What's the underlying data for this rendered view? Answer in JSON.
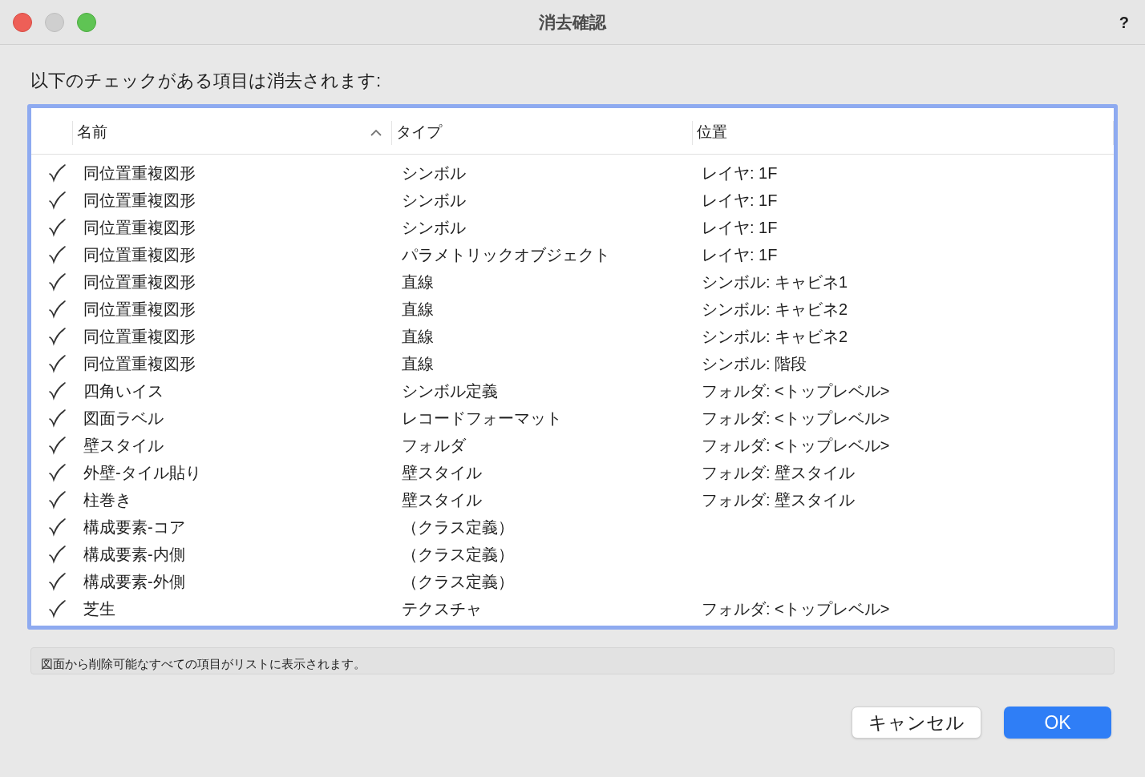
{
  "window": {
    "title": "消去確認",
    "help": "?"
  },
  "prompt": "以下のチェックがある項目は消去されます:",
  "table": {
    "columns": [
      {
        "label": "名前",
        "sorted": true
      },
      {
        "label": "タイプ",
        "sorted": false
      },
      {
        "label": "位置",
        "sorted": false
      }
    ],
    "rows": [
      {
        "checked": true,
        "name": "同位置重複図形",
        "type": "シンボル",
        "location": "レイヤ: 1F"
      },
      {
        "checked": true,
        "name": "同位置重複図形",
        "type": "シンボル",
        "location": "レイヤ: 1F"
      },
      {
        "checked": true,
        "name": "同位置重複図形",
        "type": "シンボル",
        "location": "レイヤ: 1F"
      },
      {
        "checked": true,
        "name": "同位置重複図形",
        "type": "パラメトリックオブジェクト",
        "location": "レイヤ: 1F"
      },
      {
        "checked": true,
        "name": "同位置重複図形",
        "type": "直線",
        "location": "シンボル: キャビネ1"
      },
      {
        "checked": true,
        "name": "同位置重複図形",
        "type": "直線",
        "location": "シンボル: キャビネ2"
      },
      {
        "checked": true,
        "name": "同位置重複図形",
        "type": "直線",
        "location": "シンボル: キャビネ2"
      },
      {
        "checked": true,
        "name": "同位置重複図形",
        "type": "直線",
        "location": "シンボル: 階段"
      },
      {
        "checked": true,
        "name": "四角いイス",
        "type": "シンボル定義",
        "location": "フォルダ: <トップレベル>"
      },
      {
        "checked": true,
        "name": "図面ラベル",
        "type": "レコードフォーマット",
        "location": "フォルダ: <トップレベル>"
      },
      {
        "checked": true,
        "name": "壁スタイル",
        "type": "フォルダ",
        "location": "フォルダ: <トップレベル>"
      },
      {
        "checked": true,
        "name": "外壁-タイル貼り",
        "type": "壁スタイル",
        "location": "フォルダ: 壁スタイル"
      },
      {
        "checked": true,
        "name": "柱巻き",
        "type": "壁スタイル",
        "location": "フォルダ: 壁スタイル"
      },
      {
        "checked": true,
        "name": "構成要素-コア",
        "type": "（クラス定義）"
      },
      {
        "checked": true,
        "name": "構成要素-内側",
        "type": "（クラス定義）"
      },
      {
        "checked": true,
        "name": "構成要素-外側",
        "type": "（クラス定義）"
      },
      {
        "checked": true,
        "name": "芝生",
        "type": "テクスチャ",
        "location": "フォルダ: <トップレベル>"
      }
    ]
  },
  "info": "図面から削除可能なすべての項目がリストに表示されます。",
  "buttons": [
    {
      "label": "キャンセル",
      "kind": "secondary"
    },
    {
      "label": "OK",
      "kind": "primary"
    }
  ]
}
